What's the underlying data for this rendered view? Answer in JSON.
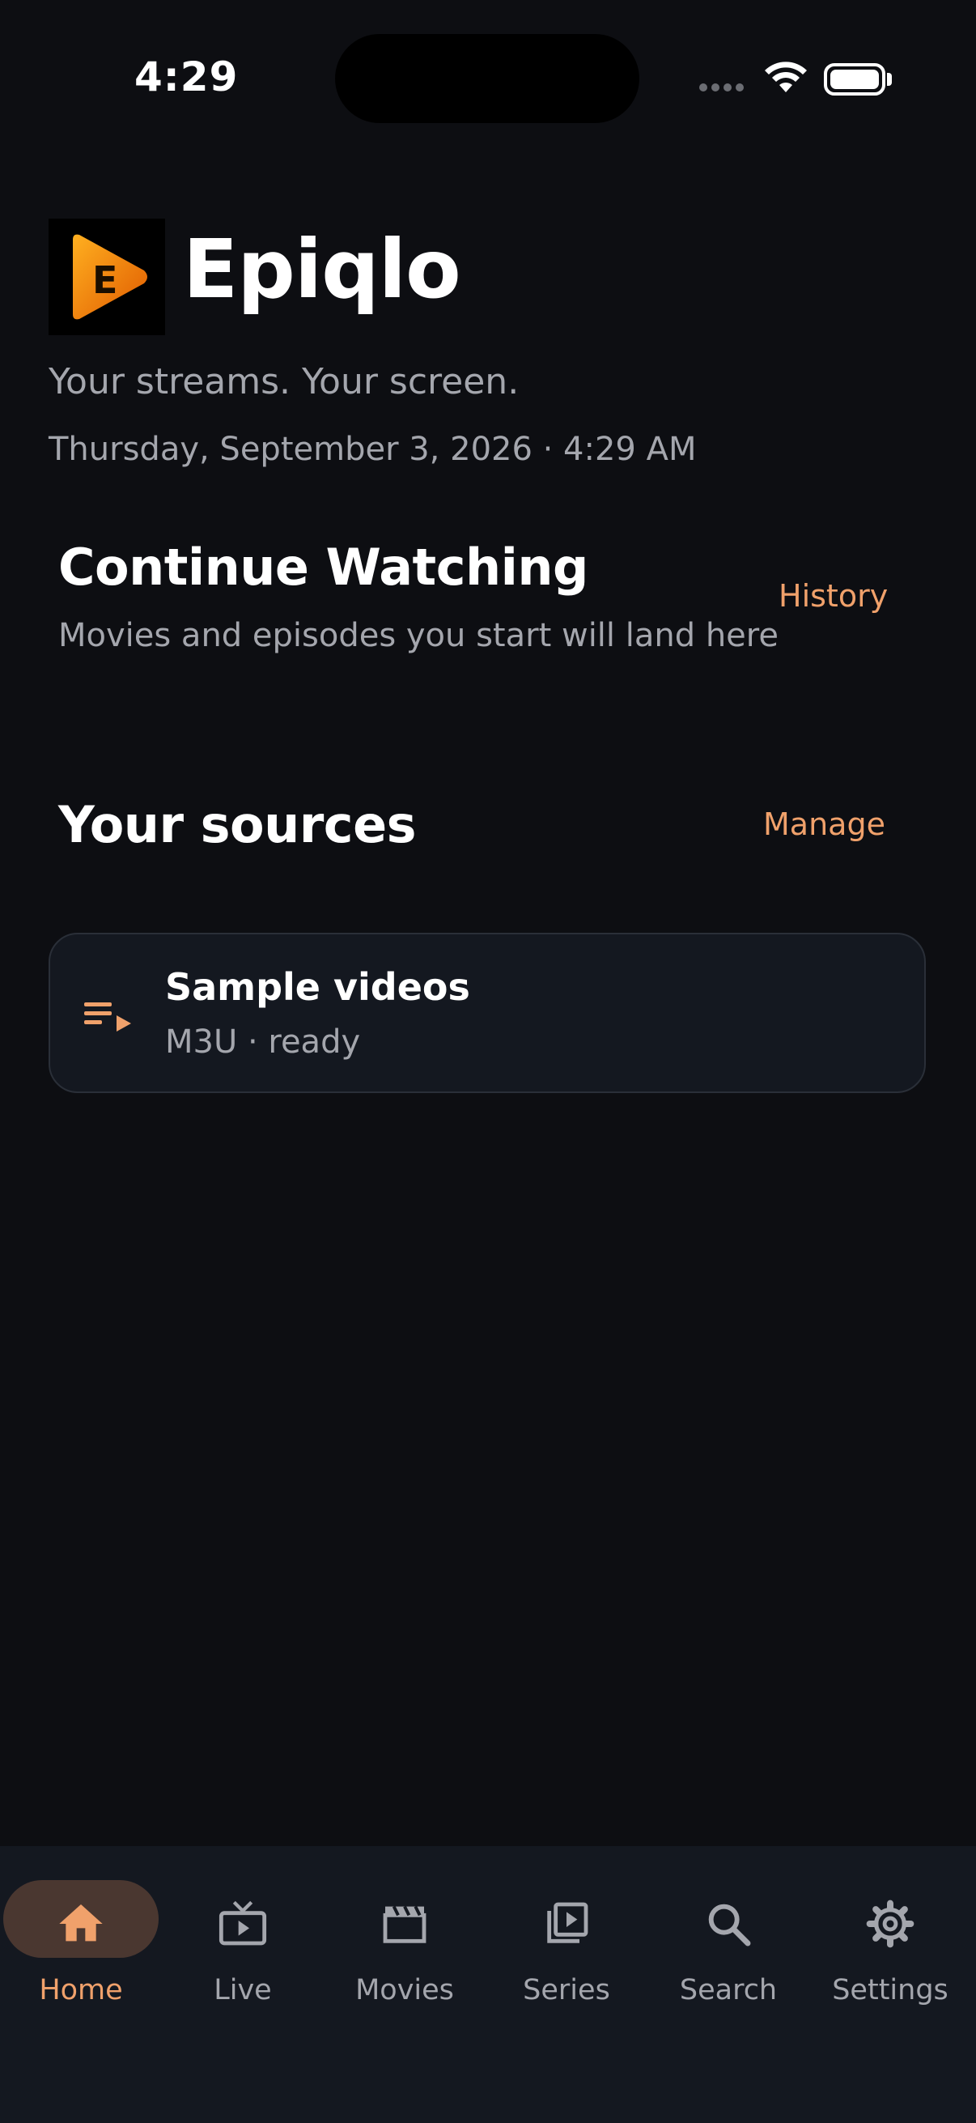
{
  "status_bar": {
    "time": "4:29"
  },
  "header": {
    "app_name": "Epiqlo",
    "logo_letter": "E",
    "tagline": "Your streams. Your screen.",
    "datetime": "Thursday, September 3, 2026 · 4:29 AM"
  },
  "continue_watching": {
    "title": "Continue Watching",
    "subtitle": "Movies and episodes you start will land here",
    "history_label": "History"
  },
  "sources": {
    "title": "Your sources",
    "manage_label": "Manage",
    "items": [
      {
        "name": "Sample videos",
        "meta": "M3U · ready",
        "icon": "playlist-play-icon"
      }
    ]
  },
  "nav": {
    "items": [
      {
        "label": "Home",
        "icon": "home-icon",
        "active": true
      },
      {
        "label": "Live",
        "icon": "live-tv-icon",
        "active": false
      },
      {
        "label": "Movies",
        "icon": "clapperboard-icon",
        "active": false
      },
      {
        "label": "Series",
        "icon": "video-library-icon",
        "active": false
      },
      {
        "label": "Search",
        "icon": "search-icon",
        "active": false
      },
      {
        "label": "Settings",
        "icon": "gear-icon",
        "active": false
      }
    ]
  },
  "colors": {
    "background": "#0d0e12",
    "surface": "#141820",
    "accent": "#f0a16b",
    "muted_text": "#a4a6ad",
    "active_pill": "#4a3730"
  }
}
